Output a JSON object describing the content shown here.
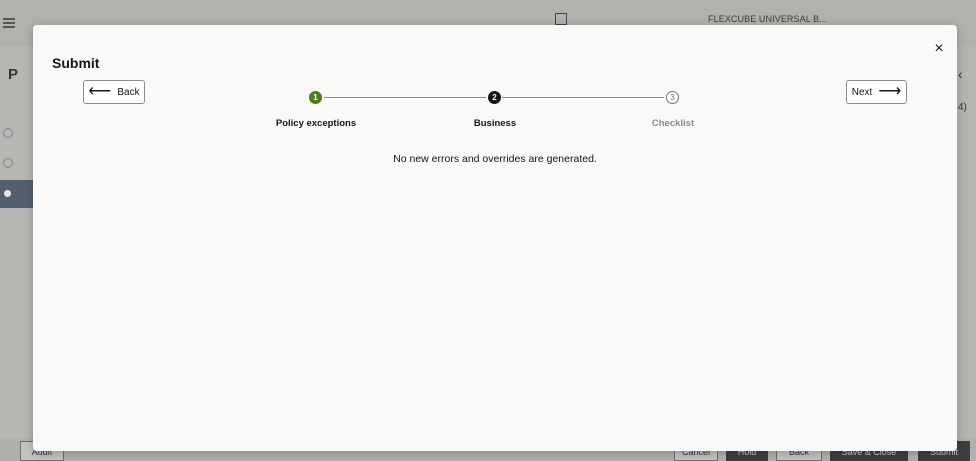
{
  "background": {
    "app_name": "FLEXCUBE UNIVERSAL B...",
    "left_letter": "P",
    "right_count": "4)",
    "footer": {
      "audit": "Audit",
      "cancel": "Cancel",
      "hold": "Hold",
      "back": "Back",
      "save_close": "Save & Close",
      "submit": "Submit"
    }
  },
  "modal": {
    "title": "Submit",
    "close_symbol": "×",
    "back_label": "Back",
    "next_label": "Next",
    "steps": [
      {
        "number": "1",
        "label": "Policy exceptions",
        "status": "completed"
      },
      {
        "number": "2",
        "label": "Business",
        "status": "current"
      },
      {
        "number": "3",
        "label": "Checklist",
        "status": "pending"
      }
    ],
    "message": "No new errors and overrides are generated."
  },
  "colors": {
    "completed_step": "#4f7d1c",
    "current_step": "#161513",
    "modal_bg": "#fbf9f8"
  }
}
